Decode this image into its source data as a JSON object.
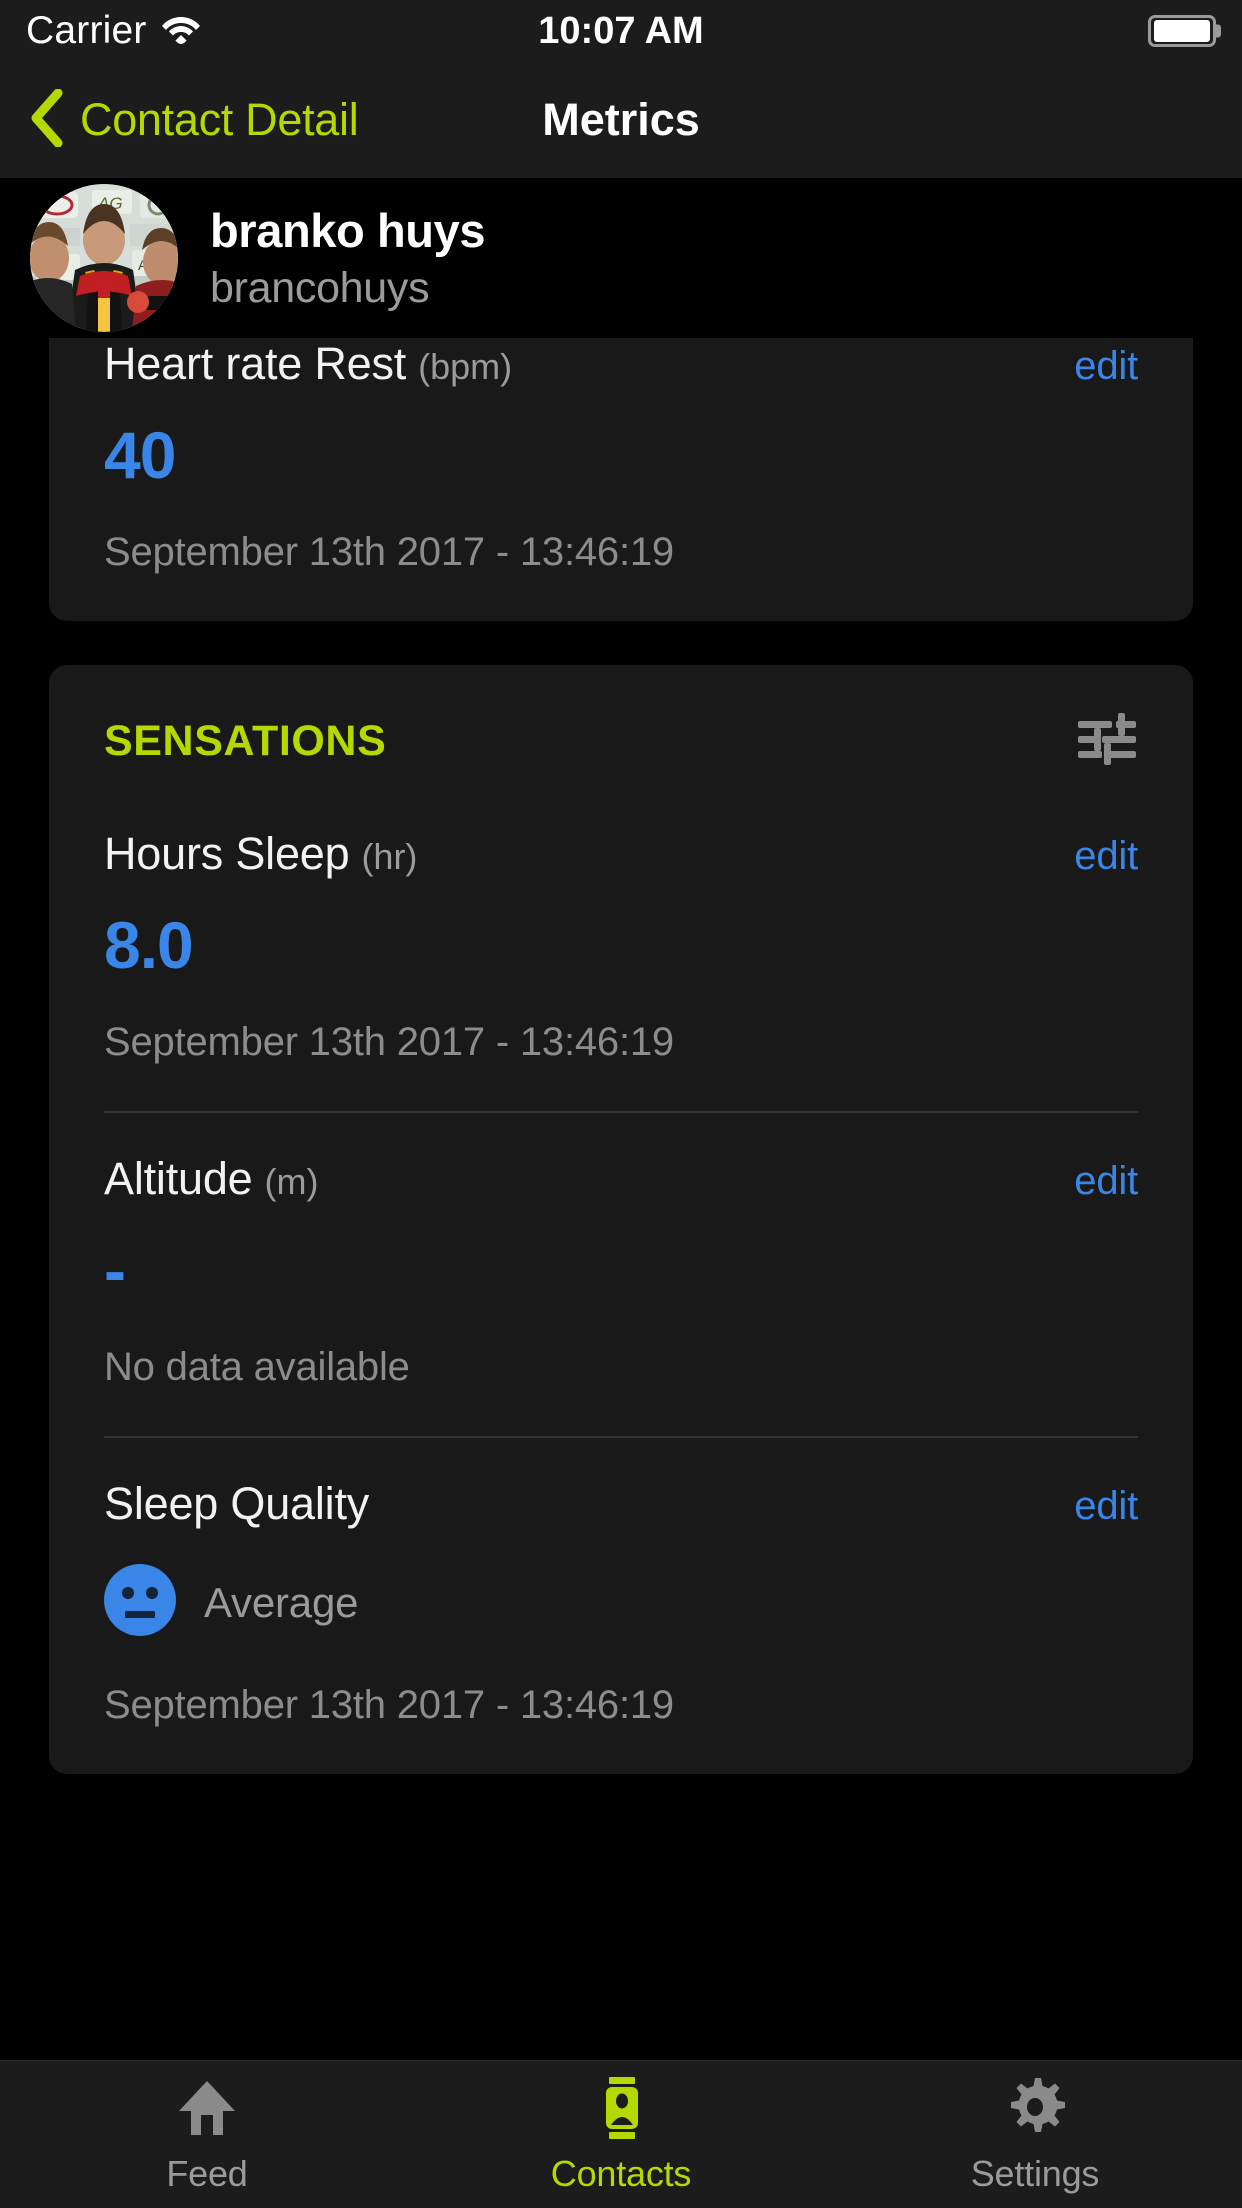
{
  "status_bar": {
    "carrier": "Carrier",
    "time": "10:07 AM",
    "wifi_icon": "wifi-icon",
    "battery_icon": "battery-full-icon"
  },
  "nav": {
    "back_label": "Contact Detail",
    "back_icon": "chevron-left-icon",
    "title": "Metrics"
  },
  "profile": {
    "name": "branko huys",
    "username": "brancohuys",
    "avatar_icon": "avatar-photo"
  },
  "colors": {
    "accent_green": "#b3d900",
    "accent_blue": "#3a86e8",
    "card_bg": "#191919",
    "page_bg": "#000000",
    "muted_text": "#8c8c8c"
  },
  "top_card": {
    "metric": {
      "title": "Heart rate Rest",
      "unit": "(bpm)",
      "edit_label": "edit",
      "value": "40",
      "date": "September 13th 2017 - 13:46:19"
    }
  },
  "sensations_card": {
    "section_title": "SENSATIONS",
    "section_icon": "sliders-icon",
    "metrics": [
      {
        "title": "Hours Sleep",
        "unit": "(hr)",
        "edit_label": "edit",
        "value": "8.0",
        "date": "September 13th 2017 - 13:46:19"
      },
      {
        "title": "Altitude",
        "unit": "(m)",
        "edit_label": "edit",
        "value": "-",
        "date": "No data available"
      },
      {
        "title": "Sleep Quality",
        "unit": "",
        "edit_label": "edit",
        "mood_icon": "neutral-face-icon",
        "mood_label": "Average",
        "date": "September 13th 2017 - 13:46:19"
      }
    ]
  },
  "tabbar": {
    "tabs": [
      {
        "label": "Feed",
        "icon": "home-icon",
        "active": false
      },
      {
        "label": "Contacts",
        "icon": "contact-card-icon",
        "active": true
      },
      {
        "label": "Settings",
        "icon": "gear-icon",
        "active": false
      }
    ]
  }
}
